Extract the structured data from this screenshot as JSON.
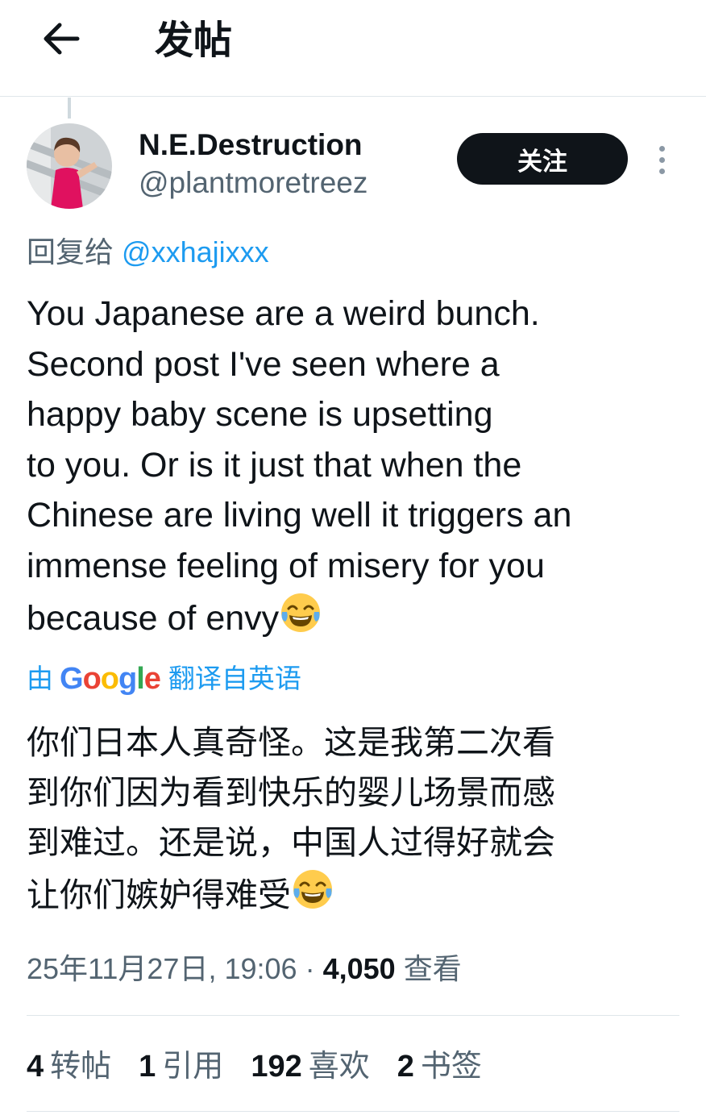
{
  "header": {
    "title": "发帖",
    "back_icon": "arrow-left-icon"
  },
  "tweet": {
    "author": {
      "display_name": "N.E.Destruction",
      "handle": "@plantmoretreez",
      "avatar_icon": "avatar-photo"
    },
    "follow_label": "关注",
    "more_icon": "more-vertical-icon",
    "reply_to": {
      "prefix": "回复给",
      "handle": "@xxhajixxx"
    },
    "text_lines": [
      "You Japanese are a weird bunch.",
      "Second post I've seen where a",
      "happy baby scene is upsetting",
      "to you. Or is it just that when the",
      "Chinese are living well it triggers an",
      "immense feeling of misery for you",
      "because of envy"
    ],
    "emoji_icon": "face-with-tears-of-joy-emoji",
    "translation": {
      "by": "由",
      "provider": "Google",
      "suffix": "翻译自英语",
      "lines": [
        "你们日本人真奇怪。这是我第二次看",
        "到你们因为看到快乐的婴儿场景而感",
        "到难过。还是说，中国人过得好就会",
        "让你们嫉妒得难受"
      ]
    },
    "timestamp": "25年11月27日, 19:06",
    "separator": "·",
    "views_count": "4,050",
    "views_label": "查看",
    "stats": {
      "reposts": {
        "count": "4",
        "label": "转帖"
      },
      "quotes": {
        "count": "1",
        "label": "引用"
      },
      "likes": {
        "count": "192",
        "label": "喜欢"
      },
      "bookmarks": {
        "count": "2",
        "label": "书签"
      }
    }
  },
  "colors": {
    "link_blue": "#1d9bf0",
    "secondary_text": "#536471",
    "primary_text": "#0f1419",
    "divider": "#dfe6ea"
  }
}
